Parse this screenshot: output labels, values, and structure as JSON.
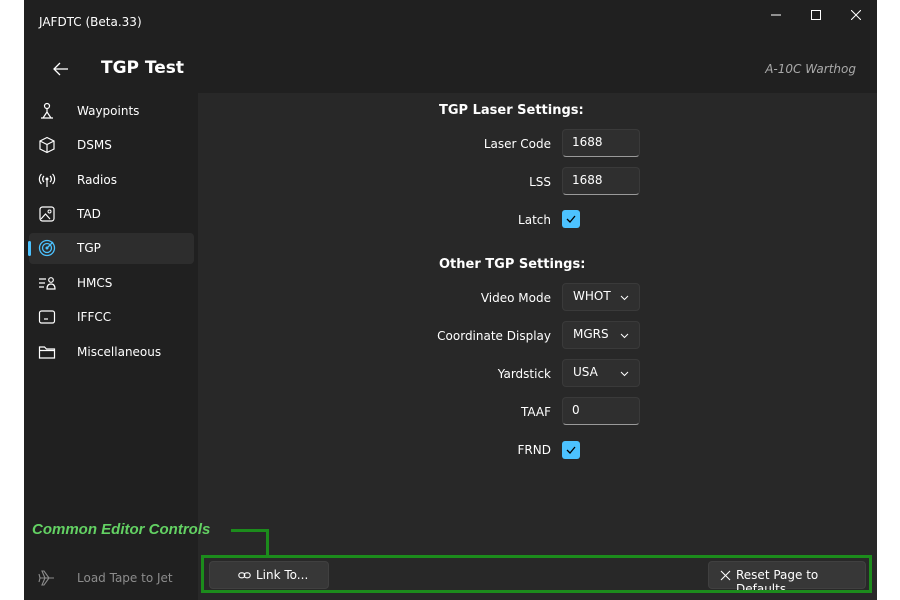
{
  "window": {
    "app_title": "JAFDTC (Beta.33)"
  },
  "header": {
    "page_title": "TGP Test",
    "airframe": "A-10C Warthog"
  },
  "sidebar": {
    "items": [
      {
        "label": "Waypoints",
        "icon": "waypoint-person-icon",
        "selected": false
      },
      {
        "label": "DSMS",
        "icon": "cube-icon",
        "selected": false
      },
      {
        "label": "Radios",
        "icon": "antenna-icon",
        "selected": false
      },
      {
        "label": "TAD",
        "icon": "image-icon",
        "selected": false
      },
      {
        "label": "TGP",
        "icon": "target-icon",
        "selected": true
      },
      {
        "label": "HMCS",
        "icon": "list-person-icon",
        "selected": false
      },
      {
        "label": "IFFCC",
        "icon": "display-icon",
        "selected": false
      },
      {
        "label": "Miscellaneous",
        "icon": "folder-icon",
        "selected": false
      }
    ],
    "load_tape_label": "Load Tape to Jet"
  },
  "laser": {
    "section_title": "TGP Laser Settings:",
    "laser_code_label": "Laser Code",
    "laser_code_value": "1688",
    "lss_label": "LSS",
    "lss_value": "1688",
    "latch_label": "Latch",
    "latch_checked": true
  },
  "other": {
    "section_title": "Other TGP Settings:",
    "video_mode_label": "Video Mode",
    "video_mode_value": "WHOT",
    "coord_display_label": "Coordinate Display",
    "coord_display_value": "MGRS",
    "yardstick_label": "Yardstick",
    "yardstick_value": "USA",
    "taaf_label": "TAAF",
    "taaf_value": "0",
    "frnd_label": "FRND",
    "frnd_checked": true
  },
  "bottom": {
    "link_label": "Link To...",
    "reset_label": "Reset Page to Defaults"
  },
  "annotation": {
    "label": "Common Editor Controls"
  },
  "colors": {
    "accent": "#4cc2ff",
    "annotation_green": "#1c8c1c",
    "annotation_text": "#63d163"
  }
}
